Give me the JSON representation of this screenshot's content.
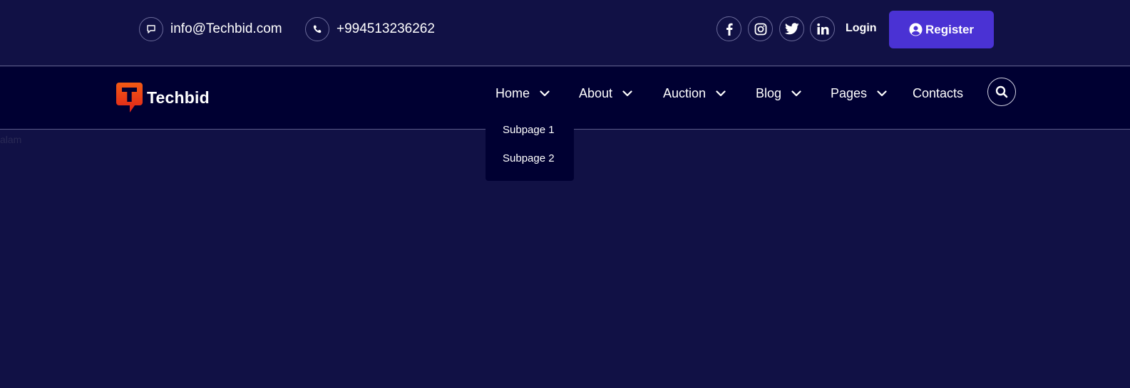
{
  "topbar": {
    "email": "info@Techbid.com",
    "phone": "+994513236262",
    "social": [
      {
        "icon": "facebook-icon"
      },
      {
        "icon": "instagram-icon"
      },
      {
        "icon": "twitter-icon"
      },
      {
        "icon": "linkedin-icon"
      }
    ],
    "login_label": "Login",
    "register_label": "Register"
  },
  "navbar": {
    "logo_text": "Techbid",
    "items": [
      {
        "label": "Home",
        "has_dropdown": true
      },
      {
        "label": "About",
        "has_dropdown": true
      },
      {
        "label": "Auction",
        "has_dropdown": true
      },
      {
        "label": "Blog",
        "has_dropdown": true
      },
      {
        "label": "Pages",
        "has_dropdown": true
      },
      {
        "label": "Contacts",
        "has_dropdown": false
      }
    ]
  },
  "dropdown": {
    "items": [
      "Subpage 1",
      "Subpage 2"
    ]
  },
  "body_text": "alam",
  "colors": {
    "background": "#111145",
    "navbar": "#000032",
    "register_button": "#4a32d4",
    "logo_orange": "#f04a12"
  }
}
